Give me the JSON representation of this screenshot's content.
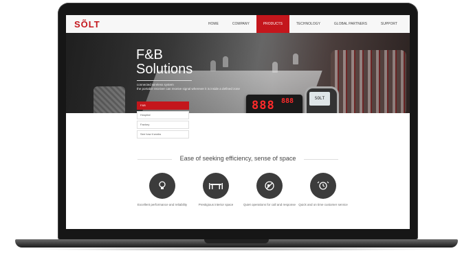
{
  "brand": {
    "logo_text": "SÕLT",
    "accent": "#c4161c"
  },
  "nav": {
    "items": [
      {
        "label": "HOME",
        "active": false
      },
      {
        "label": "COMPANY",
        "active": false
      },
      {
        "label": "PRODUCTS",
        "active": true
      },
      {
        "label": "TECHNOLOGY",
        "active": false
      },
      {
        "label": "GLOBAL PARTNERS",
        "active": false
      },
      {
        "label": "SUPPORT",
        "active": false
      }
    ]
  },
  "hero": {
    "title_line1": "F&B",
    "title_line2": "Solutions",
    "subtitle_line1": "connected wireless system",
    "subtitle_line2": "the portable receiver can receive signal wherever it is inside a defined zone",
    "device_digits": "888",
    "device_digits_small": "888",
    "watch_text": "SOLT"
  },
  "solutions_menu": [
    {
      "label": "F&B",
      "active": true
    },
    {
      "label": "Hospital",
      "active": false
    },
    {
      "label": "Factory",
      "active": false
    },
    {
      "label": "See how it works",
      "active": false
    }
  ],
  "section": {
    "title": "Ease of seeking efficiency, sense of space"
  },
  "features": [
    {
      "icon": "lightbulb-icon",
      "label": "Excellent performance and reliability"
    },
    {
      "icon": "table-icon",
      "label": "Prestigious interior space"
    },
    {
      "icon": "no-noise-icon",
      "label": "Quiet operations for call and response"
    },
    {
      "icon": "clock-service-icon",
      "label": "Quick and on time customer service"
    }
  ]
}
